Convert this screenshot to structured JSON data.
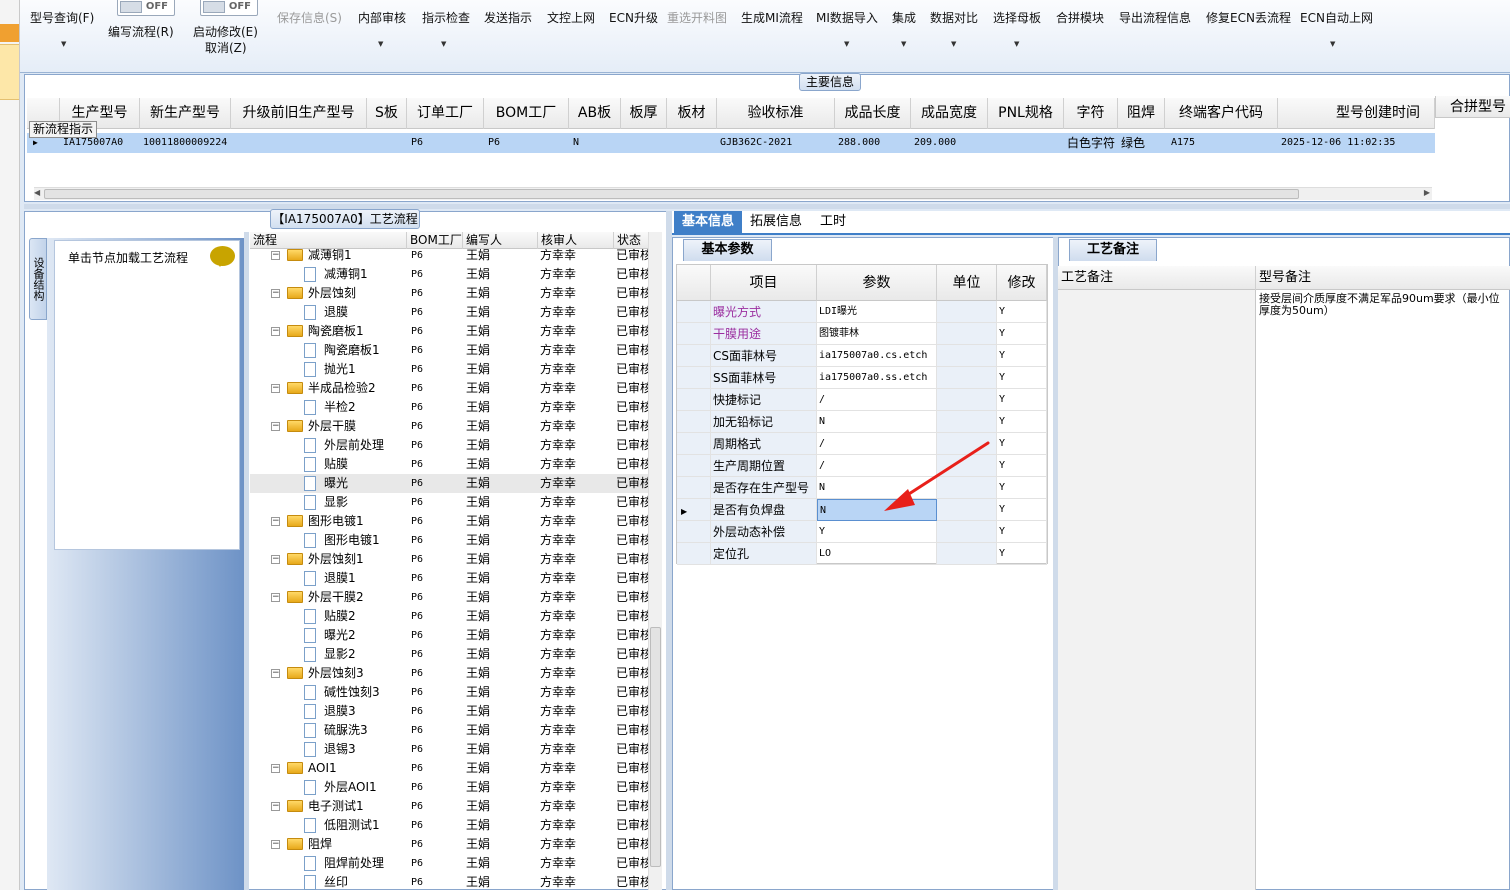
{
  "toolbar": {
    "items": [
      {
        "label": "型号查询(F)",
        "disabled": false
      },
      {
        "label": "编写流程(R)",
        "disabled": false
      },
      {
        "label": "启动修改(E)",
        "disabled": false
      },
      {
        "label": "取消(Z)",
        "disabled": false
      },
      {
        "label": "保存信息(S)",
        "disabled": true
      },
      {
        "label": "内部审核",
        "disabled": false
      },
      {
        "label": "指示检查",
        "disabled": false
      },
      {
        "label": "发送指示",
        "disabled": false
      },
      {
        "label": "文控上网",
        "disabled": false
      },
      {
        "label": "ECN升级",
        "disabled": false
      },
      {
        "label": "重选开料图",
        "disabled": true
      },
      {
        "label": "生成MI流程",
        "disabled": false
      },
      {
        "label": "MI数据导入",
        "disabled": false
      },
      {
        "label": "集成",
        "disabled": false
      },
      {
        "label": "数据对比",
        "disabled": false
      },
      {
        "label": "选择母板",
        "disabled": false
      },
      {
        "label": "合拼模块",
        "disabled": false
      },
      {
        "label": "导出流程信息",
        "disabled": false
      },
      {
        "label": "修复ECN丢流程",
        "disabled": false
      },
      {
        "label": "ECN自动上网",
        "disabled": false
      }
    ],
    "toggle1": "OFF",
    "toggle2": "OFF"
  },
  "main_info": {
    "title": "主要信息",
    "tooltip": "新流程指示",
    "columns": [
      "生产型号",
      "新生产型号",
      "升级前旧生产型号",
      "S板",
      "订单工厂",
      "BOM工厂",
      "AB板",
      "板厚",
      "板材",
      "验收标准",
      "成品长度",
      "成品宽度",
      "PNL规格",
      "字符",
      "阻焊",
      "终端客户代码",
      "型号创建时间"
    ],
    "right_header": "合拼型号",
    "row": {
      "生产型号": "IA175007A0",
      "新生产型号": "10011800009224",
      "升级前旧生产型号": "",
      "S板": "",
      "订单工厂": "P6",
      "BOM工厂": "P6",
      "AB板": "N",
      "板厚": "",
      "板材": "",
      "验收标准": "GJB362C-2021",
      "成品长度": "288.000",
      "成品宽度": "209.000",
      "PNL规格": "",
      "字符": "白色字符",
      "阻焊": "绿色",
      "终端客户代码": "A175",
      "型号创建时间": "2025-12-06 11:02:35"
    }
  },
  "process": {
    "title": "【IA175007A0】工艺流程",
    "side_tab": "设备结构",
    "hint": "单击节点加载工艺流程",
    "columns": [
      "流程",
      "BOM工厂",
      "编写人",
      "核审人",
      "状态"
    ],
    "rows": [
      {
        "level": 1,
        "name": "减薄铜1",
        "factory": "P6",
        "writer": "王娟",
        "reviewer": "方幸幸",
        "status": "已审核"
      },
      {
        "level": 2,
        "name": "减薄铜1",
        "factory": "P6",
        "writer": "王娟",
        "reviewer": "方幸幸",
        "status": "已审核"
      },
      {
        "level": 1,
        "name": "外层蚀刻",
        "factory": "P6",
        "writer": "王娟",
        "reviewer": "方幸幸",
        "status": "已审核"
      },
      {
        "level": 2,
        "name": "退膜",
        "factory": "P6",
        "writer": "王娟",
        "reviewer": "方幸幸",
        "status": "已审核"
      },
      {
        "level": 1,
        "name": "陶瓷磨板1",
        "factory": "P6",
        "writer": "王娟",
        "reviewer": "方幸幸",
        "status": "已审核"
      },
      {
        "level": 2,
        "name": "陶瓷磨板1",
        "factory": "P6",
        "writer": "王娟",
        "reviewer": "方幸幸",
        "status": "已审核"
      },
      {
        "level": 2,
        "name": "抛光1",
        "factory": "P6",
        "writer": "王娟",
        "reviewer": "方幸幸",
        "status": "已审核"
      },
      {
        "level": 1,
        "name": "半成品检验2",
        "factory": "P6",
        "writer": "王娟",
        "reviewer": "方幸幸",
        "status": "已审核"
      },
      {
        "level": 2,
        "name": "半检2",
        "factory": "P6",
        "writer": "王娟",
        "reviewer": "方幸幸",
        "status": "已审核"
      },
      {
        "level": 1,
        "name": "外层干膜",
        "factory": "P6",
        "writer": "王娟",
        "reviewer": "方幸幸",
        "status": "已审核"
      },
      {
        "level": 2,
        "name": "外层前处理",
        "factory": "P6",
        "writer": "王娟",
        "reviewer": "方幸幸",
        "status": "已审核"
      },
      {
        "level": 2,
        "name": "贴膜",
        "factory": "P6",
        "writer": "王娟",
        "reviewer": "方幸幸",
        "status": "已审核"
      },
      {
        "level": 2,
        "name": "曝光",
        "factory": "P6",
        "writer": "王娟",
        "reviewer": "方幸幸",
        "status": "已审核",
        "selected": true
      },
      {
        "level": 2,
        "name": "显影",
        "factory": "P6",
        "writer": "王娟",
        "reviewer": "方幸幸",
        "status": "已审核"
      },
      {
        "level": 1,
        "name": "图形电镀1",
        "factory": "P6",
        "writer": "王娟",
        "reviewer": "方幸幸",
        "status": "已审核"
      },
      {
        "level": 2,
        "name": "图形电镀1",
        "factory": "P6",
        "writer": "王娟",
        "reviewer": "方幸幸",
        "status": "已审核"
      },
      {
        "level": 1,
        "name": "外层蚀刻1",
        "factory": "P6",
        "writer": "王娟",
        "reviewer": "方幸幸",
        "status": "已审核"
      },
      {
        "level": 2,
        "name": "退膜1",
        "factory": "P6",
        "writer": "王娟",
        "reviewer": "方幸幸",
        "status": "已审核"
      },
      {
        "level": 1,
        "name": "外层干膜2",
        "factory": "P6",
        "writer": "王娟",
        "reviewer": "方幸幸",
        "status": "已审核"
      },
      {
        "level": 2,
        "name": "贴膜2",
        "factory": "P6",
        "writer": "王娟",
        "reviewer": "方幸幸",
        "status": "已审核"
      },
      {
        "level": 2,
        "name": "曝光2",
        "factory": "P6",
        "writer": "王娟",
        "reviewer": "方幸幸",
        "status": "已审核"
      },
      {
        "level": 2,
        "name": "显影2",
        "factory": "P6",
        "writer": "王娟",
        "reviewer": "方幸幸",
        "status": "已审核"
      },
      {
        "level": 1,
        "name": "外层蚀刻3",
        "factory": "P6",
        "writer": "王娟",
        "reviewer": "方幸幸",
        "status": "已审核"
      },
      {
        "level": 2,
        "name": "碱性蚀刻3",
        "factory": "P6",
        "writer": "王娟",
        "reviewer": "方幸幸",
        "status": "已审核"
      },
      {
        "level": 2,
        "name": "退膜3",
        "factory": "P6",
        "writer": "王娟",
        "reviewer": "方幸幸",
        "status": "已审核"
      },
      {
        "level": 2,
        "name": "硫脲洗3",
        "factory": "P6",
        "writer": "王娟",
        "reviewer": "方幸幸",
        "status": "已审核"
      },
      {
        "level": 2,
        "name": "退锡3",
        "factory": "P6",
        "writer": "王娟",
        "reviewer": "方幸幸",
        "status": "已审核"
      },
      {
        "level": 1,
        "name": "AOI1",
        "factory": "P6",
        "writer": "王娟",
        "reviewer": "方幸幸",
        "status": "已审核"
      },
      {
        "level": 2,
        "name": "外层AOI1",
        "factory": "P6",
        "writer": "王娟",
        "reviewer": "方幸幸",
        "status": "已审核"
      },
      {
        "level": 1,
        "name": "电子测试1",
        "factory": "P6",
        "writer": "王娟",
        "reviewer": "方幸幸",
        "status": "已审核"
      },
      {
        "level": 2,
        "name": "低阻测试1",
        "factory": "P6",
        "writer": "王娟",
        "reviewer": "方幸幸",
        "status": "已审核"
      },
      {
        "level": 1,
        "name": "阻焊",
        "factory": "P6",
        "writer": "王娟",
        "reviewer": "方幸幸",
        "status": "已审核"
      },
      {
        "level": 2,
        "name": "阻焊前处理",
        "factory": "P6",
        "writer": "王娟",
        "reviewer": "方幸幸",
        "status": "已审核"
      },
      {
        "level": 2,
        "name": "丝印",
        "factory": "P6",
        "writer": "王娟",
        "reviewer": "方幸幸",
        "status": "已审核"
      }
    ]
  },
  "tabs": [
    "基本信息",
    "拓展信息",
    "工时"
  ],
  "params": {
    "title": "基本参数",
    "columns": [
      "项目",
      "参数",
      "单位",
      "修改"
    ],
    "rows": [
      {
        "item": "曝光方式",
        "value": "LDI曝光",
        "unit": "",
        "modified": "Y",
        "highlight": true
      },
      {
        "item": "干膜用途",
        "value": "图镀菲林",
        "unit": "",
        "modified": "Y",
        "highlight": true
      },
      {
        "item": "CS面菲林号",
        "value": "ia175007a0.cs.etch",
        "unit": "",
        "modified": "Y"
      },
      {
        "item": "SS面菲林号",
        "value": "ia175007a0.ss.etch",
        "unit": "",
        "modified": "Y"
      },
      {
        "item": "快捷标记",
        "value": "/",
        "unit": "",
        "modified": "Y"
      },
      {
        "item": "加无铅标记",
        "value": "N",
        "unit": "",
        "modified": "Y"
      },
      {
        "item": "周期格式",
        "value": "/",
        "unit": "",
        "modified": "Y"
      },
      {
        "item": "生产周期位置",
        "value": "/",
        "unit": "",
        "modified": "Y"
      },
      {
        "item": "是否存在生产型号",
        "value": "N",
        "unit": "",
        "modified": "Y"
      },
      {
        "item": "是否有负焊盘",
        "value": "N",
        "unit": "",
        "modified": "Y",
        "selected": true
      },
      {
        "item": "外层动态补偿",
        "value": "Y",
        "unit": "",
        "modified": "Y"
      },
      {
        "item": "定位孔",
        "value": "LO",
        "unit": "",
        "modified": "Y"
      }
    ]
  },
  "remarks": {
    "title": "工艺备注",
    "col1": "工艺备注",
    "col2": "型号备注",
    "text": "接受层间介质厚度不满足军品90um要求（最小位厚度为50um）"
  },
  "colors": {
    "accent": "#3f7fc8",
    "selection": "#b9d5f5",
    "highlight_text": "#9b2ea0",
    "annotation_arrow": "#e8201a"
  }
}
